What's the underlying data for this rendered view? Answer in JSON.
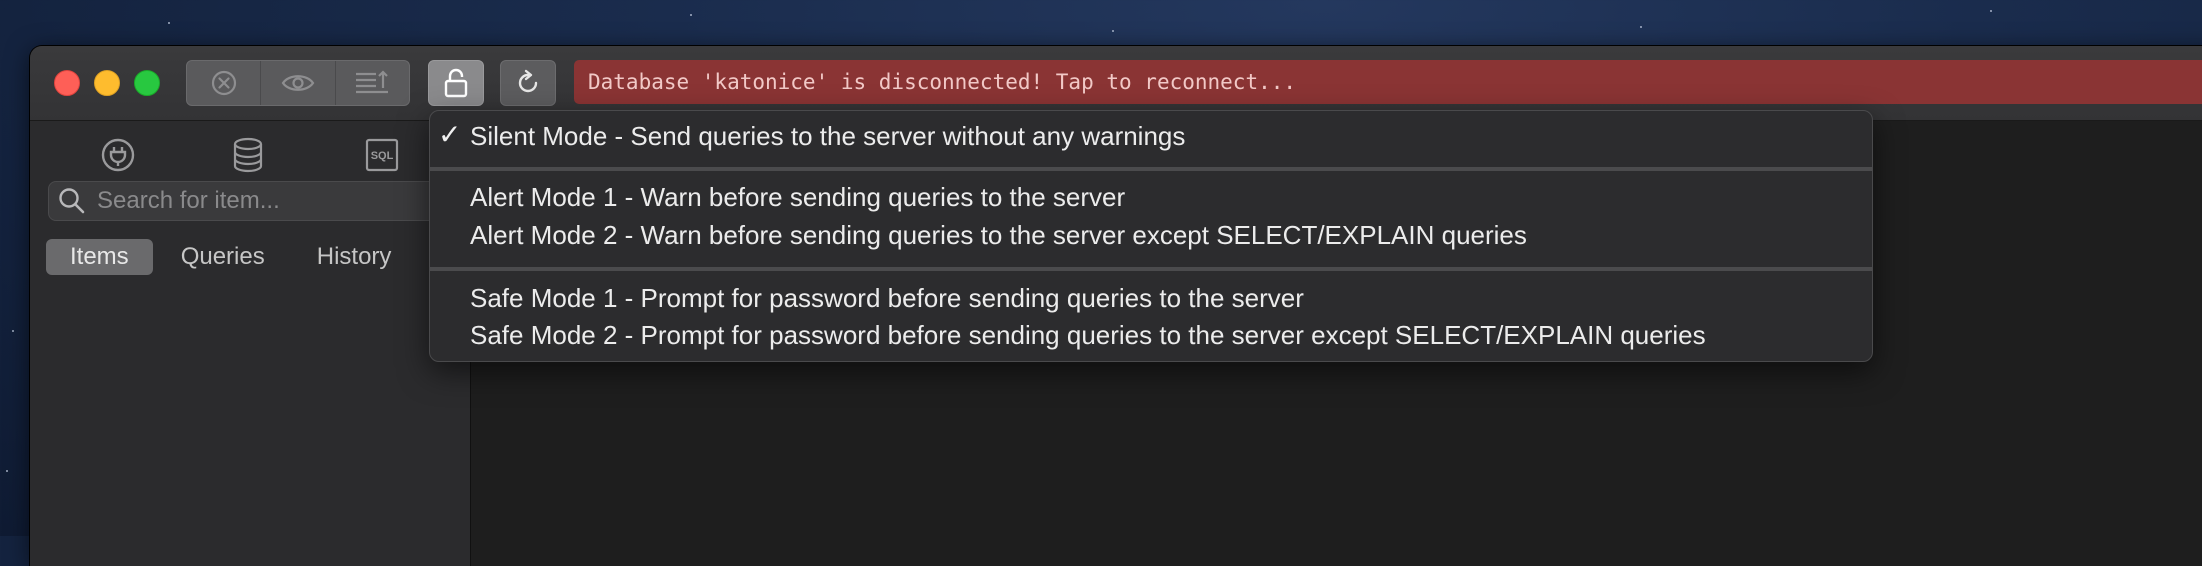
{
  "toolbar": {
    "status_message": "Database 'katonice' is disconnected! Tap to reconnect..."
  },
  "sidebar": {
    "search_placeholder": "Search for item...",
    "tabs": [
      {
        "label": "Items"
      },
      {
        "label": "Queries"
      },
      {
        "label": "History"
      }
    ],
    "icons": [
      "plug-icon",
      "database-icon",
      "sql-icon"
    ],
    "sql_icon_text": "SQL"
  },
  "menu": {
    "checkmark": "✓",
    "items": [
      {
        "label": "Silent Mode - Send queries to the server without any warnings",
        "checked": true
      },
      {
        "label": "Alert Mode 1 - Warn before sending queries to the server",
        "checked": false
      },
      {
        "label": "Alert Mode 2 - Warn before sending queries to the server except SELECT/EXPLAIN queries",
        "checked": false
      },
      {
        "label": "Safe Mode 1 - Prompt for password before sending queries to the server",
        "checked": false
      },
      {
        "label": "Safe Mode 2 - Prompt for password before sending queries to the server except SELECT/EXPLAIN queries",
        "checked": false
      }
    ]
  },
  "colors": {
    "status_bg": "#8a3434",
    "status_text": "#f2c9c7",
    "close": "#fe5f57",
    "minimize": "#febc2e",
    "maximize": "#28c840"
  }
}
